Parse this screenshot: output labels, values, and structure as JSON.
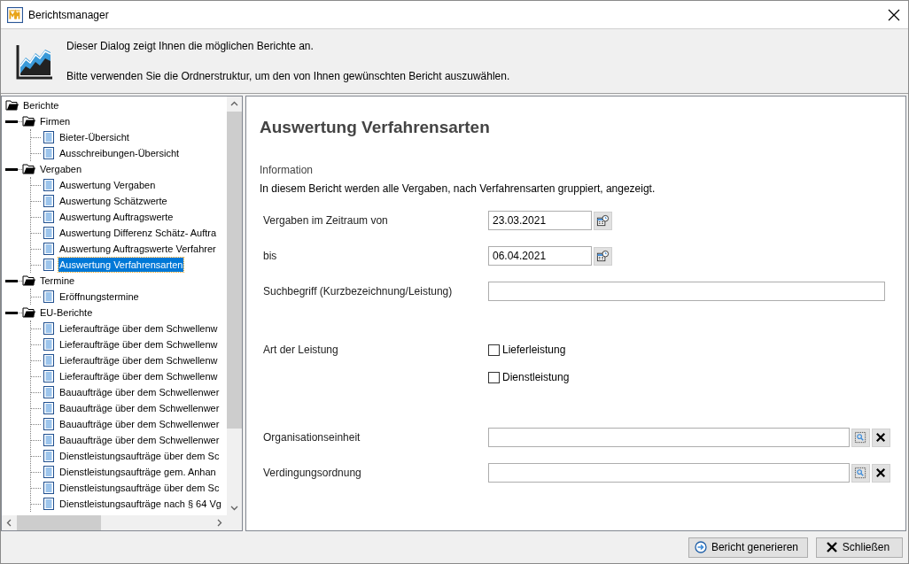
{
  "window": {
    "title": "Berichtsmanager"
  },
  "header": {
    "lines": [
      "Dieser Dialog zeigt Ihnen die möglichen Berichte an.",
      "Bitte verwenden Sie die Ordnerstruktur, um den von Ihnen gewünschten Bericht auszuwählen."
    ]
  },
  "tree": [
    {
      "label": "Berichte",
      "kind": "folder",
      "selected": false,
      "children": [
        {
          "label": "Firmen",
          "kind": "folder",
          "expanded": true,
          "selected": false,
          "children": [
            {
              "label": "Bieter-Übersicht",
              "kind": "report",
              "selected": false
            },
            {
              "label": "Ausschreibungen-Übersicht",
              "kind": "report",
              "selected": false
            }
          ]
        },
        {
          "label": "Vergaben",
          "kind": "folder",
          "expanded": true,
          "selected": false,
          "children": [
            {
              "label": "Auswertung Vergaben",
              "kind": "report",
              "selected": false
            },
            {
              "label": "Auswertung Schätzwerte",
              "kind": "report",
              "selected": false
            },
            {
              "label": "Auswertung Auftragswerte",
              "kind": "report",
              "selected": false
            },
            {
              "label": "Auswertung Differenz Schätz- Auftra",
              "kind": "report",
              "selected": false
            },
            {
              "label": "Auswertung Auftragswerte Verfahrer",
              "kind": "report",
              "selected": false
            },
            {
              "label": "Auswertung Verfahrensarten",
              "kind": "report",
              "selected": true
            }
          ]
        },
        {
          "label": "Termine",
          "kind": "folder",
          "expanded": true,
          "selected": false,
          "children": [
            {
              "label": "Eröffnungstermine",
              "kind": "report",
              "selected": false
            }
          ]
        },
        {
          "label": "EU-Berichte",
          "kind": "folder",
          "expanded": true,
          "selected": false,
          "children": [
            {
              "label": "Lieferaufträge über dem Schwellenw",
              "kind": "report",
              "selected": false
            },
            {
              "label": "Lieferaufträge über dem Schwellenw",
              "kind": "report",
              "selected": false
            },
            {
              "label": "Lieferaufträge über dem Schwellenw",
              "kind": "report",
              "selected": false
            },
            {
              "label": "Lieferaufträge über dem Schwellenw",
              "kind": "report",
              "selected": false
            },
            {
              "label": "Bauaufträge über dem Schwellenwer",
              "kind": "report",
              "selected": false
            },
            {
              "label": "Bauaufträge über dem Schwellenwer",
              "kind": "report",
              "selected": false
            },
            {
              "label": "Bauaufträge über dem Schwellenwer",
              "kind": "report",
              "selected": false
            },
            {
              "label": "Bauaufträge über dem Schwellenwer",
              "kind": "report",
              "selected": false
            },
            {
              "label": "Dienstleistungsaufträge über dem Sc",
              "kind": "report",
              "selected": false
            },
            {
              "label": "Dienstleistungsaufträge gem. Anhan",
              "kind": "report",
              "selected": false
            },
            {
              "label": "Dienstleistungsaufträge über dem Sc",
              "kind": "report",
              "selected": false
            },
            {
              "label": "Dienstleistungsaufträge nach § 64 Vg",
              "kind": "report",
              "selected": false
            }
          ]
        }
      ]
    }
  ],
  "report": {
    "title": "Auswertung Verfahrensarten",
    "section_label": "Information",
    "description": "In diesem Bericht werden alle Vergaben, nach Verfahrensarten gruppiert, angezeigt.",
    "fields": [
      {
        "kind": "date",
        "label": "Vergaben im Zeitraum von",
        "value": "23.03.2021"
      },
      {
        "kind": "date",
        "label": "bis",
        "value": "06.04.2021"
      },
      {
        "kind": "text",
        "label": "Suchbegriff (Kurzbezeichnung/Leistung)"
      },
      {
        "kind": "checks",
        "label": "Art der Leistung",
        "options": [
          {
            "label": "Lieferleistung",
            "checked": false
          },
          {
            "label": "Dienstleistung",
            "checked": false
          }
        ]
      },
      {
        "kind": "lookup",
        "label": "Organisationseinheit"
      },
      {
        "kind": "lookup",
        "label": "Verdingungsordnung"
      }
    ]
  },
  "buttons": [
    {
      "kind": "generate",
      "label": "Bericht generieren"
    },
    {
      "kind": "close",
      "label": "Schließen"
    }
  ]
}
